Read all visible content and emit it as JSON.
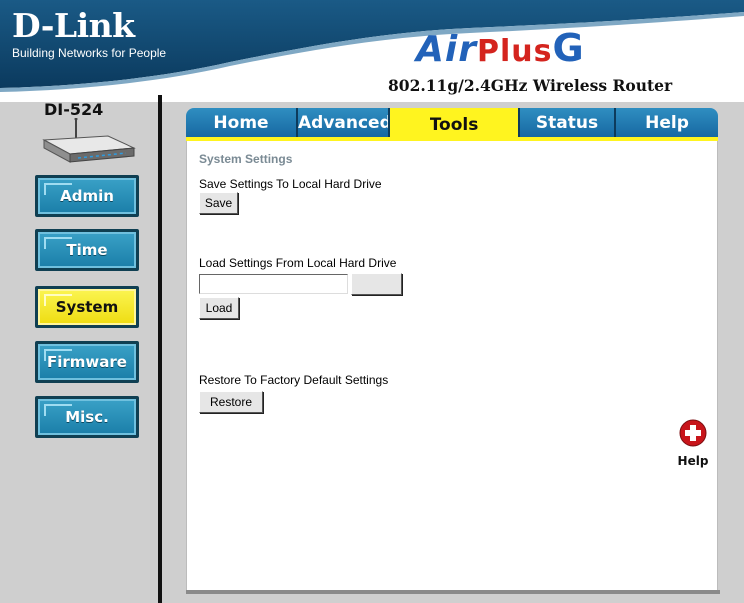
{
  "header": {
    "brand_name": "D-Link",
    "brand_tagline": "Building Networks for People",
    "product_air": "Air",
    "product_plus": "Plus",
    "product_g": "G",
    "product_subtitle": "802.11g/2.4GHz Wireless Router",
    "colors": {
      "banner": "#10466e",
      "logo_blue": "#2262b9",
      "logo_red": "#d4241e"
    }
  },
  "sidebar": {
    "model": "DI-524",
    "router_icon": "router-icon",
    "items": [
      {
        "label": "Admin",
        "active": false
      },
      {
        "label": "Time",
        "active": false
      },
      {
        "label": "System",
        "active": true
      },
      {
        "label": "Firmware",
        "active": false
      },
      {
        "label": "Misc.",
        "active": false
      }
    ]
  },
  "tabs": [
    {
      "label": "Home",
      "active": false
    },
    {
      "label": "Advanced",
      "active": false
    },
    {
      "label": "Tools",
      "active": true
    },
    {
      "label": "Status",
      "active": false
    },
    {
      "label": "Help",
      "active": false
    }
  ],
  "content": {
    "title": "System Settings",
    "save_section_label": "Save Settings To Local Hard Drive",
    "save_button": "Save",
    "load_section_label": "Load Settings From Local Hard Drive",
    "file_input_value": "",
    "browse_button": "",
    "load_button": "Load",
    "restore_section_label": "Restore To Factory Default Settings",
    "restore_button": "Restore",
    "help_label": "Help",
    "help_icon": "plus-circle-icon"
  },
  "colors": {
    "tab_blue": "#1f7ab3",
    "tab_active": "#fff41f",
    "side_button_blue": "#2a8fbb",
    "side_button_active": "#f4e620",
    "sidebar_bg": "#cfcfcf"
  }
}
